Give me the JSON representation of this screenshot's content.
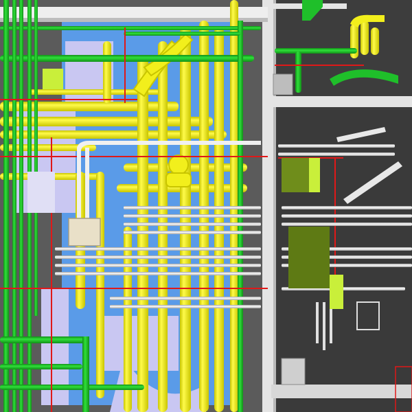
{
  "scene": {
    "subject": "bim-mep-pipe-routing-3d-view",
    "colors": {
      "background_dark": "#3a3a3a",
      "floor_blue": "#5a9be8",
      "lavender_structure": "#c9c7f2",
      "yellow_pipe": "#f2ef1c",
      "yellow_shadow": "#c9c500",
      "green_pipe": "#1fbf2a",
      "green_shadow": "#129018",
      "red_line": "#e01818",
      "white_pipe": "#f5f5f5",
      "gray_box": "#bdbdbd",
      "beige_box": "#e9e0c8",
      "olive_panel": "#6f8d1b",
      "lime_panel": "#c9ef3a",
      "concrete_beam": "#dedede"
    },
    "legend": []
  }
}
